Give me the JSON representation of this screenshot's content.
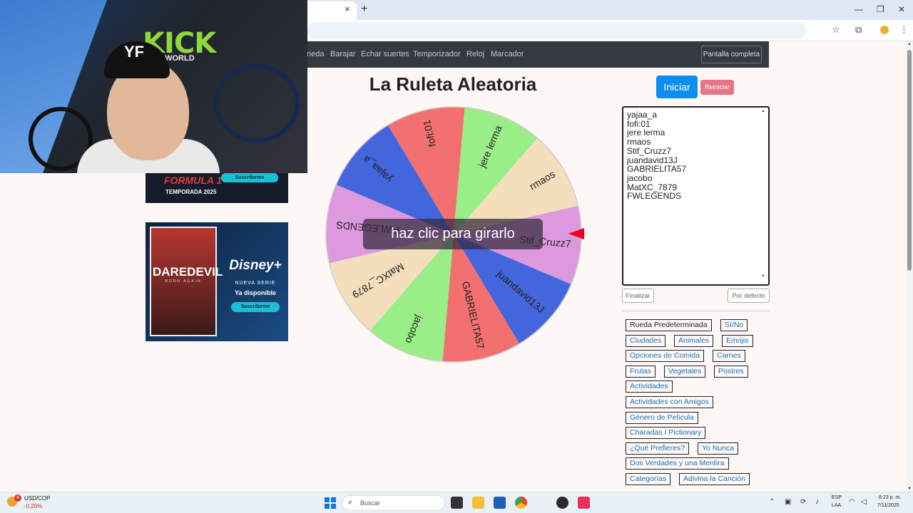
{
  "browser": {
    "tab_close": "×",
    "new_tab": "+",
    "controls": {
      "minimize": "—",
      "restore": "❐",
      "close": "✕"
    },
    "icons": {
      "star": "☆",
      "extensions": "⧉",
      "menu": "⋮"
    }
  },
  "nav": {
    "items": [
      "neda",
      "Barajar",
      "Echar suertes",
      "Temporizador",
      "Reloj",
      "Marcador"
    ],
    "fullscreen": "Pantalla completa"
  },
  "webcam": {
    "brand": "KICK",
    "sub": "ELIWORLD",
    "cap_logo": "YF"
  },
  "ads": {
    "ad1": {
      "brand": "FORMULA 1",
      "season": "TEMPORADA 2025",
      "button": "Suscribirme"
    },
    "ad2": {
      "poster_title": "DAREDEVIL",
      "poster_sub": "BORN AGAIN",
      "brand": "Disney+",
      "line1": "NUEVA SERIE",
      "line2": "Ya disponible",
      "button": "Suscribirme"
    }
  },
  "main": {
    "title": "La Ruleta Aleatoria",
    "spin_hint": "haz clic para girarlo"
  },
  "wheel": {
    "segments": [
      {
        "label": "Stif_Cruzz7",
        "color": "#dd99dd"
      },
      {
        "label": "juandavid13J",
        "color": "#4466dd"
      },
      {
        "label": "GABRIELITA57",
        "color": "#f27070"
      },
      {
        "label": "jacobo",
        "color": "#99ee88"
      },
      {
        "label": "MatXC_7879",
        "color": "#f3dfbb"
      },
      {
        "label": "FWLEGENDS",
        "color": "#dd99dd"
      },
      {
        "label": "yajaa_a",
        "color": "#4466dd"
      },
      {
        "label": "fofi:01",
        "color": "#f27070"
      },
      {
        "label": "jere lerma",
        "color": "#99ee88"
      },
      {
        "label": "rmaos",
        "color": "#f3dfbb"
      }
    ]
  },
  "controls": {
    "start": "Iniciar",
    "reset": "Reiniciar",
    "finish": "Finalizar",
    "default": "Por defecto"
  },
  "names": [
    "yajaa_a",
    "fofi:01",
    "jere lerma",
    "rmaos",
    "Stif_Cruzz7",
    "juandavid13J",
    "GABRIELITA57",
    "jacobo",
    "MatXC_7879",
    "FWLEGENDS"
  ],
  "presets": [
    "Rueda Predeterminada",
    "Sí/No",
    "Ciudades",
    "Animales",
    "Emojis",
    "Opciones de Comida",
    "Carnes",
    "Frutas",
    "Vegetales",
    "Postres",
    "Actividades",
    "Actividades con Amigos",
    "Género de Película",
    "Charadas / Pictionary",
    "¿Qué Prefieres?",
    "Yo Nunca",
    "Dos Verdades y una Mentira",
    "Categorías",
    "Adivina la Canción"
  ],
  "taskbar": {
    "stock_name": "USD/COP",
    "stock_change": "-0,26%",
    "badge": "4",
    "search": "Buscar",
    "lang1": "ESP",
    "lang2": "LAA",
    "time": "8:23 p. m.",
    "date": "7/11/2025"
  }
}
